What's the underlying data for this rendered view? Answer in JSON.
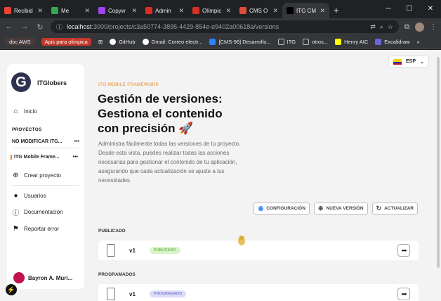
{
  "browser": {
    "tabs": [
      {
        "title": "Recibid",
        "color": "#ea4335"
      },
      {
        "title": "Me",
        "color": "#34a853"
      },
      {
        "title": "Copyw",
        "color": "#a142f4"
      },
      {
        "title": "Admin",
        "color": "#d93025"
      },
      {
        "title": "Olímpic",
        "color": "#d93025"
      },
      {
        "title": "CMS O",
        "color": "#e04e39"
      },
      {
        "title": "ITG CM",
        "color": "#000000"
      }
    ],
    "active_tab": 6,
    "url_host": "localhost",
    "url_path": ":3000/projects/c3a50774-3895-4429-854e-e9402a00618a/versions",
    "bookmarks": [
      {
        "label": "doc AWS"
      },
      {
        "label": "Apis para olimpica"
      },
      {
        "label": "GitHub"
      },
      {
        "label": "Gmail: Correo electr..."
      },
      {
        "label": "[CMS-96] Desarrollo..."
      },
      {
        "label": "ITG"
      },
      {
        "label": "otros..."
      },
      {
        "label": "Henry AIC"
      },
      {
        "label": "Excalidraw"
      }
    ]
  },
  "sidebar": {
    "brand": "ITGlobers",
    "logo_letter": "G",
    "home": "Inicio",
    "projects_heading": "PROYECTOS",
    "projects": [
      {
        "name": "NO MODIFICAR ITG...",
        "dots": "•••"
      },
      {
        "name": "ITG Mobile Frame...",
        "dots": "•••"
      }
    ],
    "create_project": "Crear proyecto",
    "users": "Usuarios",
    "docs": "Documentación",
    "report": "Reportar error",
    "user_name": "Bayron A. Muri..."
  },
  "lang": {
    "code": "ESP"
  },
  "main": {
    "kicker": "ITG MOBILE FRAMEWORK",
    "title_line1": "Gestión de versiones:",
    "title_line2": "Gestiona el contenido",
    "title_line3": "con precisión 🚀",
    "description": "Administra fácilmente todas las versiones de tu proyecto. Desde esta vista, puedes realizar todas las acciones necesarias para gestionar el contenido de tu aplicación, asegurando que cada actualización se ajuste a tus necesidades.",
    "actions": {
      "config": "CONFIGURACIÓN",
      "new_version": "NUEVA VERSIÓN",
      "update": "ACTUALIZAR"
    },
    "published_heading": "PUBLICADO",
    "published": {
      "name": "v1",
      "badge": "PUBLICADO"
    },
    "scheduled_heading": "PROGRAMADOS",
    "scheduled": {
      "name": "v1",
      "badge": "PROGRAMADO"
    }
  }
}
